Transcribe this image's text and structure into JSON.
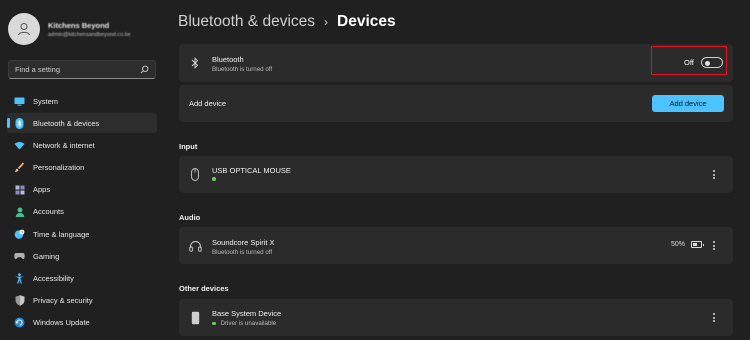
{
  "profile": {
    "name": "Kitchens Beyond",
    "email": "admin@kitchensandbeyond.co.ke"
  },
  "search": {
    "placeholder": "Find a setting",
    "icon": "search-icon"
  },
  "sidebar": {
    "items": [
      {
        "label": "System",
        "icon": "display-icon",
        "color": "#4cc2ff",
        "active": false
      },
      {
        "label": "Bluetooth & devices",
        "icon": "bluetooth-icon",
        "color": "#4cc2ff",
        "active": true
      },
      {
        "label": "Network & internet",
        "icon": "wifi-icon",
        "color": "#4cc2ff",
        "active": false
      },
      {
        "label": "Personalization",
        "icon": "brush-icon",
        "color": "#f7a35c",
        "active": false
      },
      {
        "label": "Apps",
        "icon": "apps-icon",
        "color": "#a0a0d0",
        "active": false
      },
      {
        "label": "Accounts",
        "icon": "person-icon",
        "color": "#3ec28f",
        "active": false
      },
      {
        "label": "Time & language",
        "icon": "globe-clock-icon",
        "color": "#4cc2ff",
        "active": false
      },
      {
        "label": "Gaming",
        "icon": "gamepad-icon",
        "color": "#b0b0b0",
        "active": false
      },
      {
        "label": "Accessibility",
        "icon": "accessibility-icon",
        "color": "#4cc2ff",
        "active": false
      },
      {
        "label": "Privacy & security",
        "icon": "shield-icon",
        "color": "#9a9a9a",
        "active": false
      },
      {
        "label": "Windows Update",
        "icon": "update-icon",
        "color": "#4cc2ff",
        "active": false
      }
    ]
  },
  "breadcrumb": {
    "parent": "Bluetooth & devices",
    "separator": "›",
    "current": "Devices"
  },
  "bluetooth": {
    "title": "Bluetooth",
    "status": "Bluetooth is turned off",
    "toggle_label": "Off",
    "toggle_on": false
  },
  "add_device": {
    "label": "Add device",
    "button_label": "Add device"
  },
  "sections": {
    "input": "Input",
    "audio": "Audio",
    "other": "Other devices"
  },
  "devices": {
    "mouse": {
      "name": "USB OPTICAL MOUSE",
      "status": ""
    },
    "headset": {
      "name": "Soundcore Spirit X",
      "status": "Bluetooth is turned off",
      "battery": "50%",
      "battery_level": 0.5
    },
    "base": {
      "name": "Base System Device",
      "status": "Driver is unavailable"
    }
  },
  "colors": {
    "accent": "#4cc2ff",
    "highlight_box": "#e81123",
    "connected_dot": "#6ccb5f"
  }
}
